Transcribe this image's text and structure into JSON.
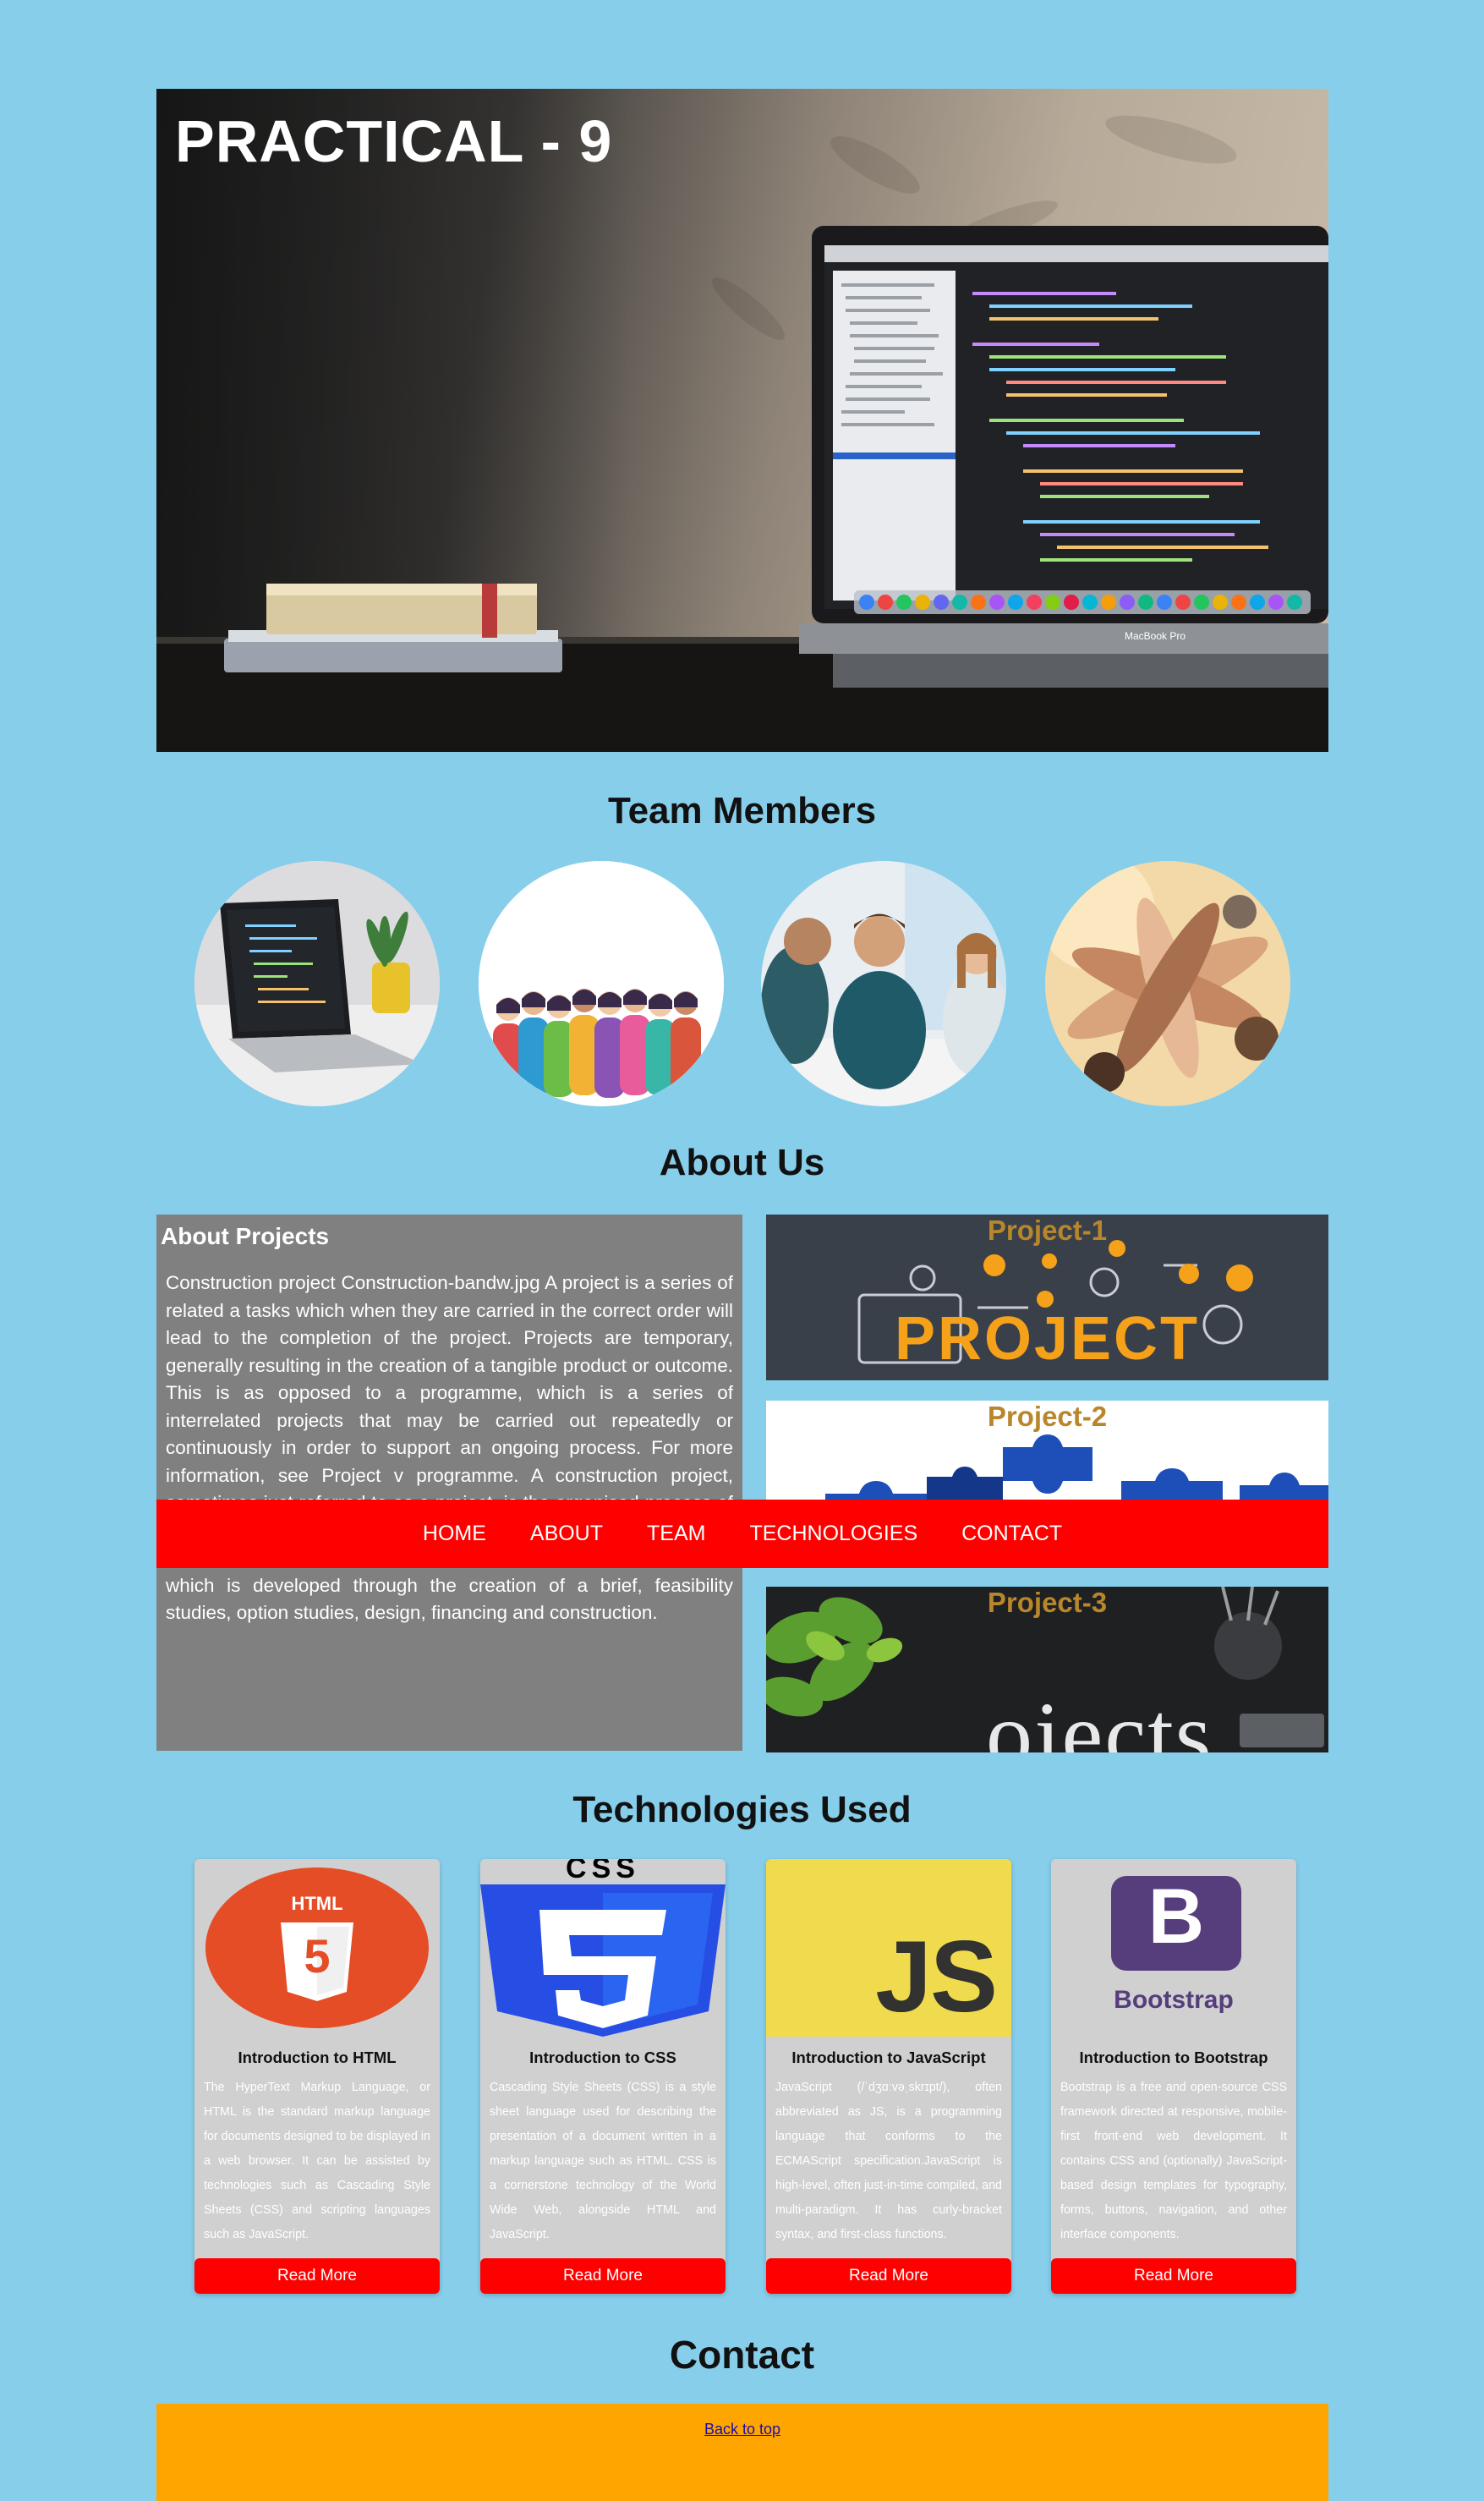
{
  "hero": {
    "title": "PRACTICAL - 9",
    "laptop_brand": "MacBook Pro"
  },
  "team": {
    "heading": "Team Members",
    "members": [
      {
        "alt": "laptop-with-code"
      },
      {
        "alt": "crowd-illustration"
      },
      {
        "alt": "office-meeting"
      },
      {
        "alt": "hands-together"
      }
    ]
  },
  "about": {
    "heading": "About Us",
    "panel_title": "About Projects",
    "text": "Construction project Construction-bandw.jpg A project is a series of related a tasks which when they are carried in the correct order will lead to the completion of the project. Projects are temporary, generally resulting in the creation of a tangible product or outcome. This is as opposed to a programme, which is a series of interrelated projects that may be carried out repeatedly or continuously in order to support an ongoing process. For more information, see Project v programme. A construction project, sometimes just referred to as a project, is the organised process of constructing, redeveloping, refurbishing, retrofitting or adapting buildings. It will usually be driven by an overarching requirement which is developed through the creation of a brief, feasibility studies, option studies, design, financing and construction.",
    "projects": [
      {
        "title": "Project-1",
        "image_word": "PROJECT"
      },
      {
        "title": "Project-2"
      },
      {
        "title": "Project-3",
        "image_word": "ojects"
      }
    ]
  },
  "nav": {
    "items": [
      "HOME",
      "ABOUT",
      "TEAM",
      "TECHNOLOGIES",
      "CONTACT"
    ]
  },
  "technologies": {
    "heading": "Technologies Used",
    "cards": [
      {
        "title": "Introduction to HTML",
        "logo_text": "HTML",
        "logo_num": "5",
        "text": "The HyperText Markup Language, or HTML is the standard markup language for documents designed to be displayed in a web browser. It can be assisted by technologies such as Cascading Style Sheets (CSS) and scripting languages such as JavaScript.",
        "button": "Read More"
      },
      {
        "title": "Introduction to CSS",
        "logo_text": "CSS",
        "logo_num": "3",
        "text": "Cascading Style Sheets (CSS) is a style sheet language used for describing the presentation of a document written in a markup language such as HTML. CSS is a cornerstone technology of the World Wide Web, alongside HTML and JavaScript.",
        "button": "Read More"
      },
      {
        "title": "Introduction to JavaScript",
        "logo_text": "JS",
        "text": "JavaScript (/ˈdʒɑːvəˌskrɪpt/), often abbreviated as JS, is a programming language that conforms to the ECMAScript specification.JavaScript is high-level, often just-in-time compiled, and multi-paradigm. It has curly-bracket syntax, and first-class functions.",
        "button": "Read More"
      },
      {
        "title": "Introduction to Bootstrap",
        "logo_text": "B",
        "logo_word": "Bootstrap",
        "text": "Bootstrap is a free and open-source CSS framework directed at responsive, mobile-first front-end web development. It contains CSS and (optionally) JavaScript-based design templates for typography, forms, buttons, navigation, and other interface components.",
        "button": "Read More"
      }
    ]
  },
  "contact": {
    "heading": "Contact",
    "back_to_top": "Back to top"
  },
  "colors": {
    "background": "#87CEEB",
    "nav": "#FF0000",
    "footer": "#FFA500",
    "about_panel": "#808080",
    "project_title": "#B8862B"
  }
}
